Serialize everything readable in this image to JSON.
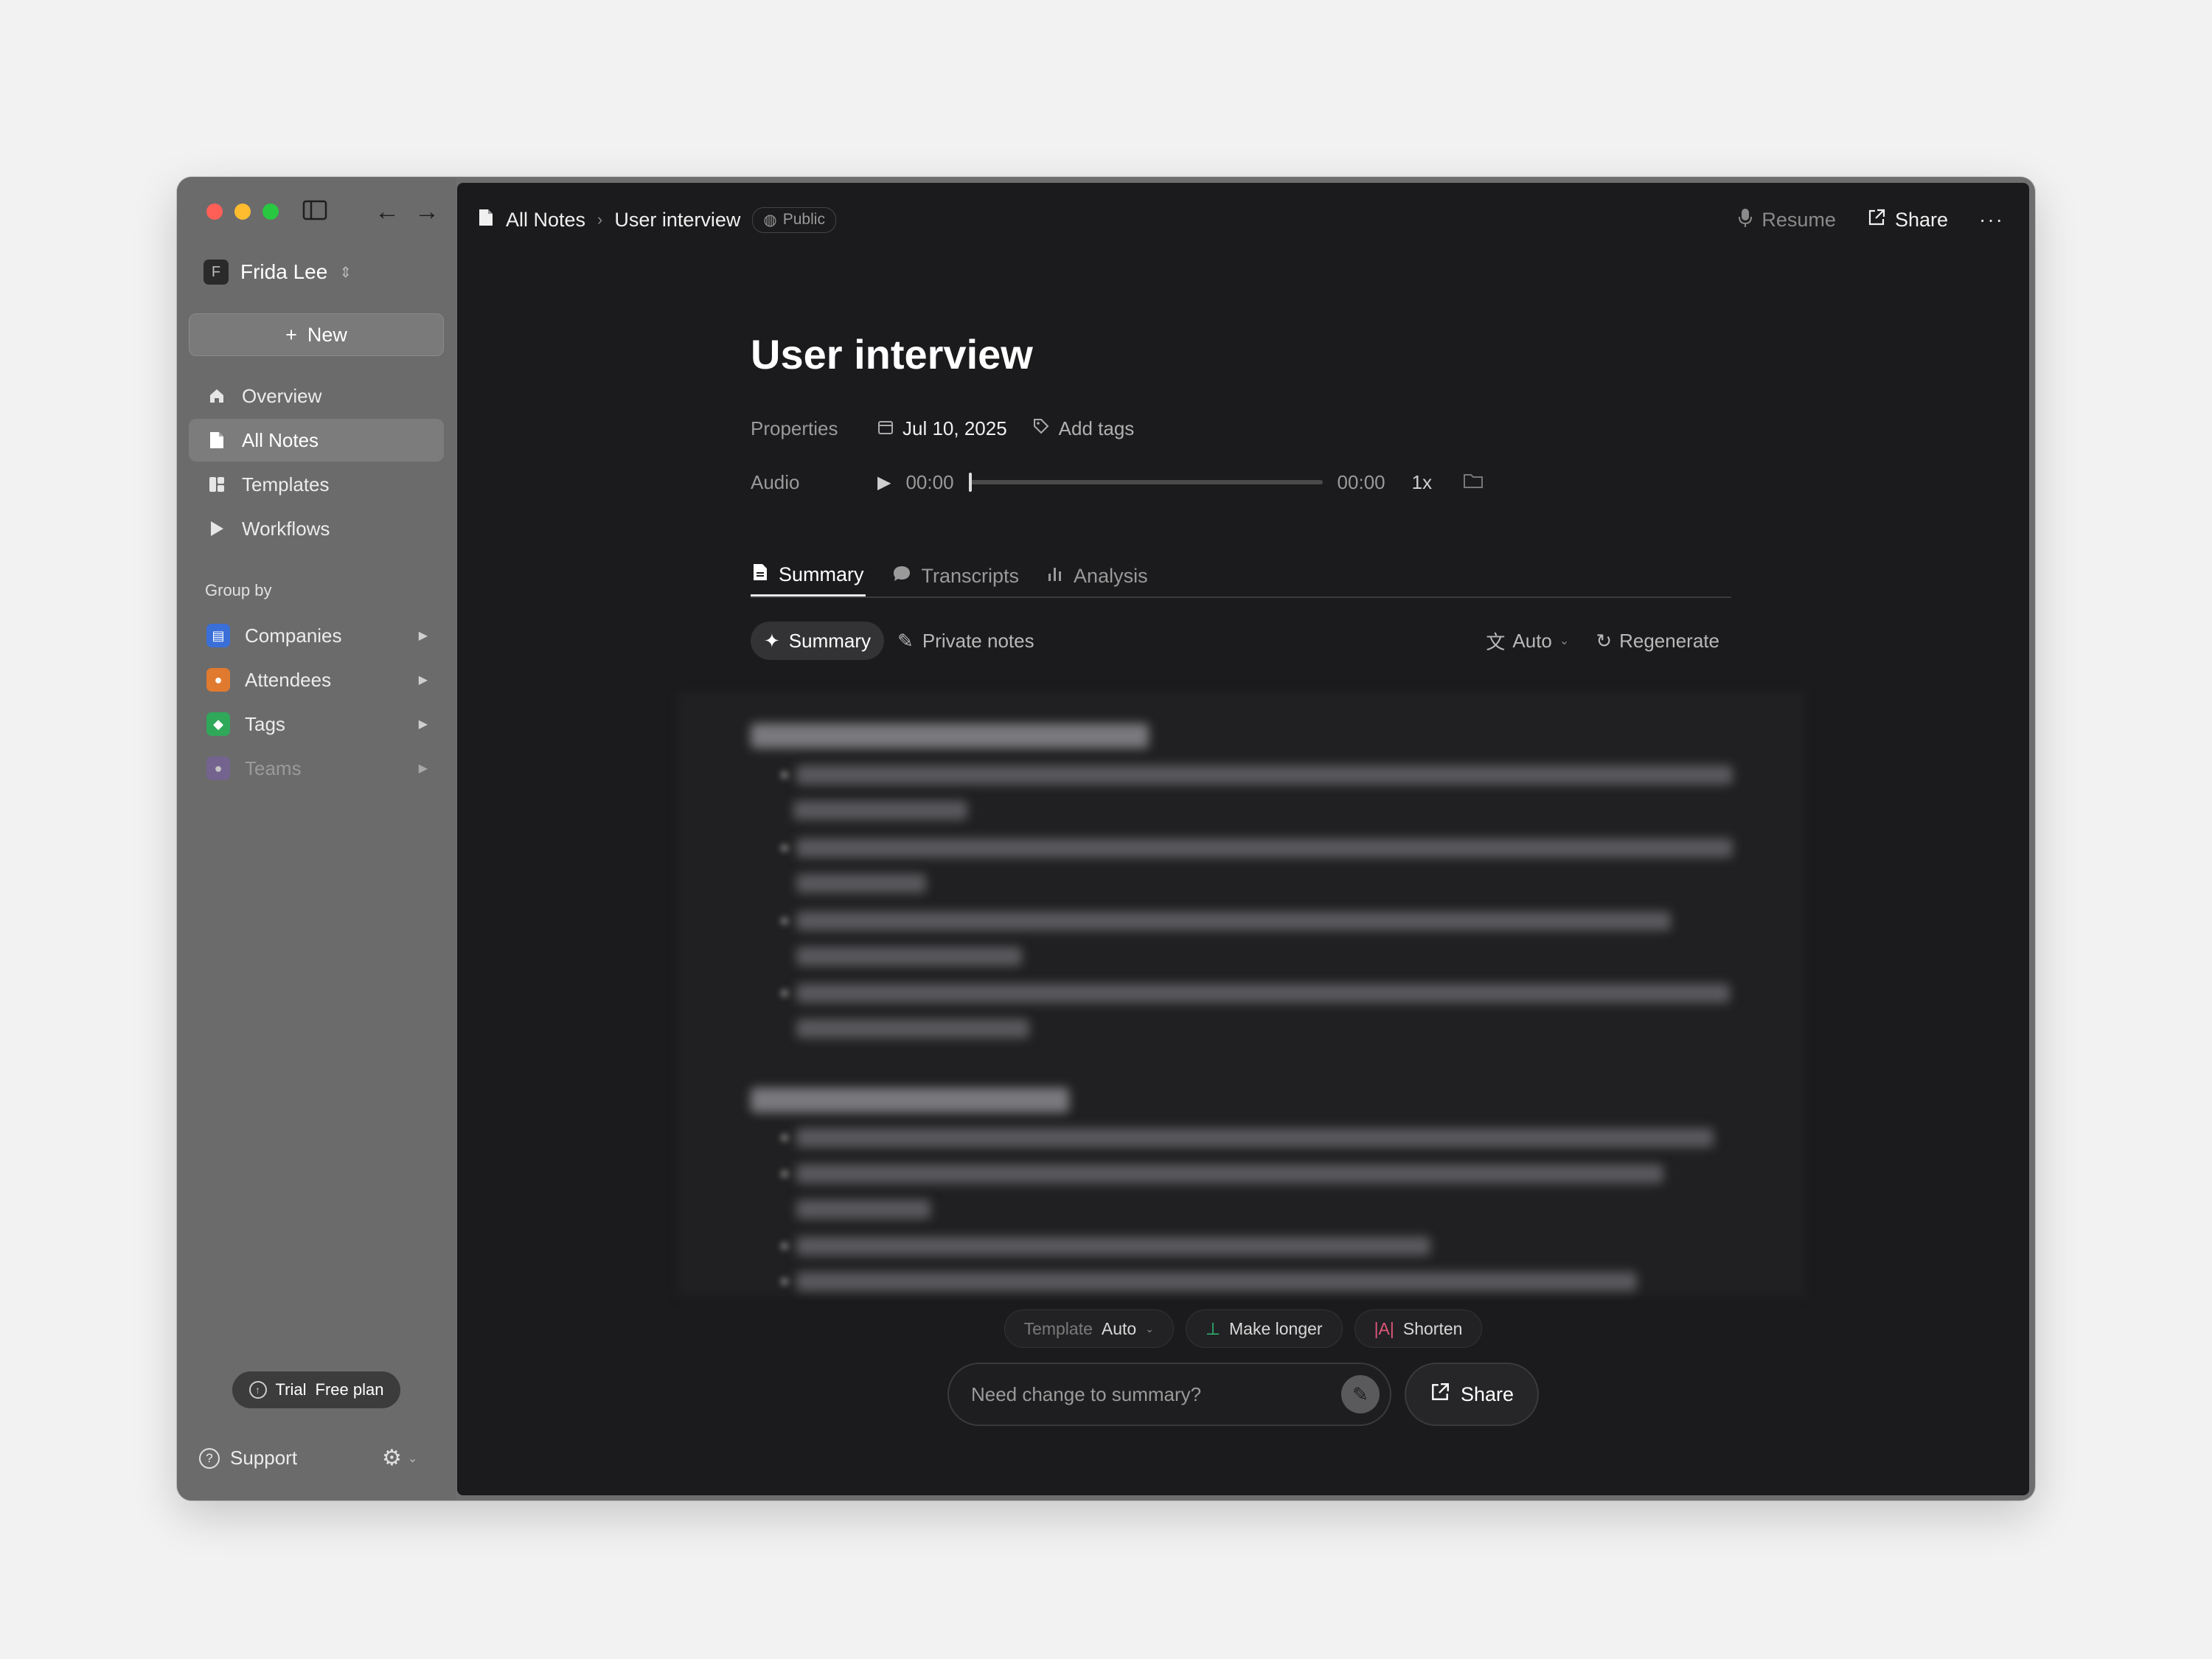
{
  "sidebar": {
    "user": {
      "initial": "F",
      "name": "Frida Lee"
    },
    "new_label": "New",
    "nav": [
      {
        "label": "Overview",
        "icon": "home-icon"
      },
      {
        "label": "All Notes",
        "icon": "note-icon"
      },
      {
        "label": "Templates",
        "icon": "template-icon"
      },
      {
        "label": "Workflows",
        "icon": "play-icon"
      }
    ],
    "group_by_label": "Group by",
    "groups": [
      {
        "label": "Companies",
        "icon": "building-icon",
        "color": "#3b6fd8"
      },
      {
        "label": "Attendees",
        "icon": "person-icon",
        "color": "#e07a2e"
      },
      {
        "label": "Tags",
        "icon": "tag-icon",
        "color": "#2fa85a"
      },
      {
        "label": "Teams",
        "icon": "team-icon",
        "color": "#7b5ea8"
      }
    ],
    "trial": {
      "label": "Trial",
      "plan": "Free plan"
    },
    "support_label": "Support"
  },
  "topbar": {
    "breadcrumb_root": "All Notes",
    "breadcrumb_current": "User interview",
    "visibility": "Public",
    "resume_label": "Resume",
    "share_label": "Share",
    "more_label": "···"
  },
  "doc": {
    "title": "User interview",
    "properties_label": "Properties",
    "date": "Jul 10, 2025",
    "add_tags_label": "Add tags",
    "audio_label": "Audio",
    "time_current": "00:00",
    "time_total": "00:00",
    "speed": "1x",
    "progress": 0
  },
  "tabs": [
    {
      "label": "Summary",
      "active": true
    },
    {
      "label": "Transcripts",
      "active": false
    },
    {
      "label": "Analysis",
      "active": false
    }
  ],
  "subtabs": {
    "summary": "Summary",
    "private_notes": "Private notes",
    "language": "Auto",
    "regenerate": "Regenerate"
  },
  "bottom": {
    "template_label": "Template",
    "template_value": "Auto",
    "make_longer": "Make longer",
    "shorten": "Shorten",
    "input_placeholder": "Need change to summary?",
    "share_label": "Share"
  },
  "colors": {
    "accent_green": "#2fc27a",
    "accent_pink": "#e0567a"
  }
}
